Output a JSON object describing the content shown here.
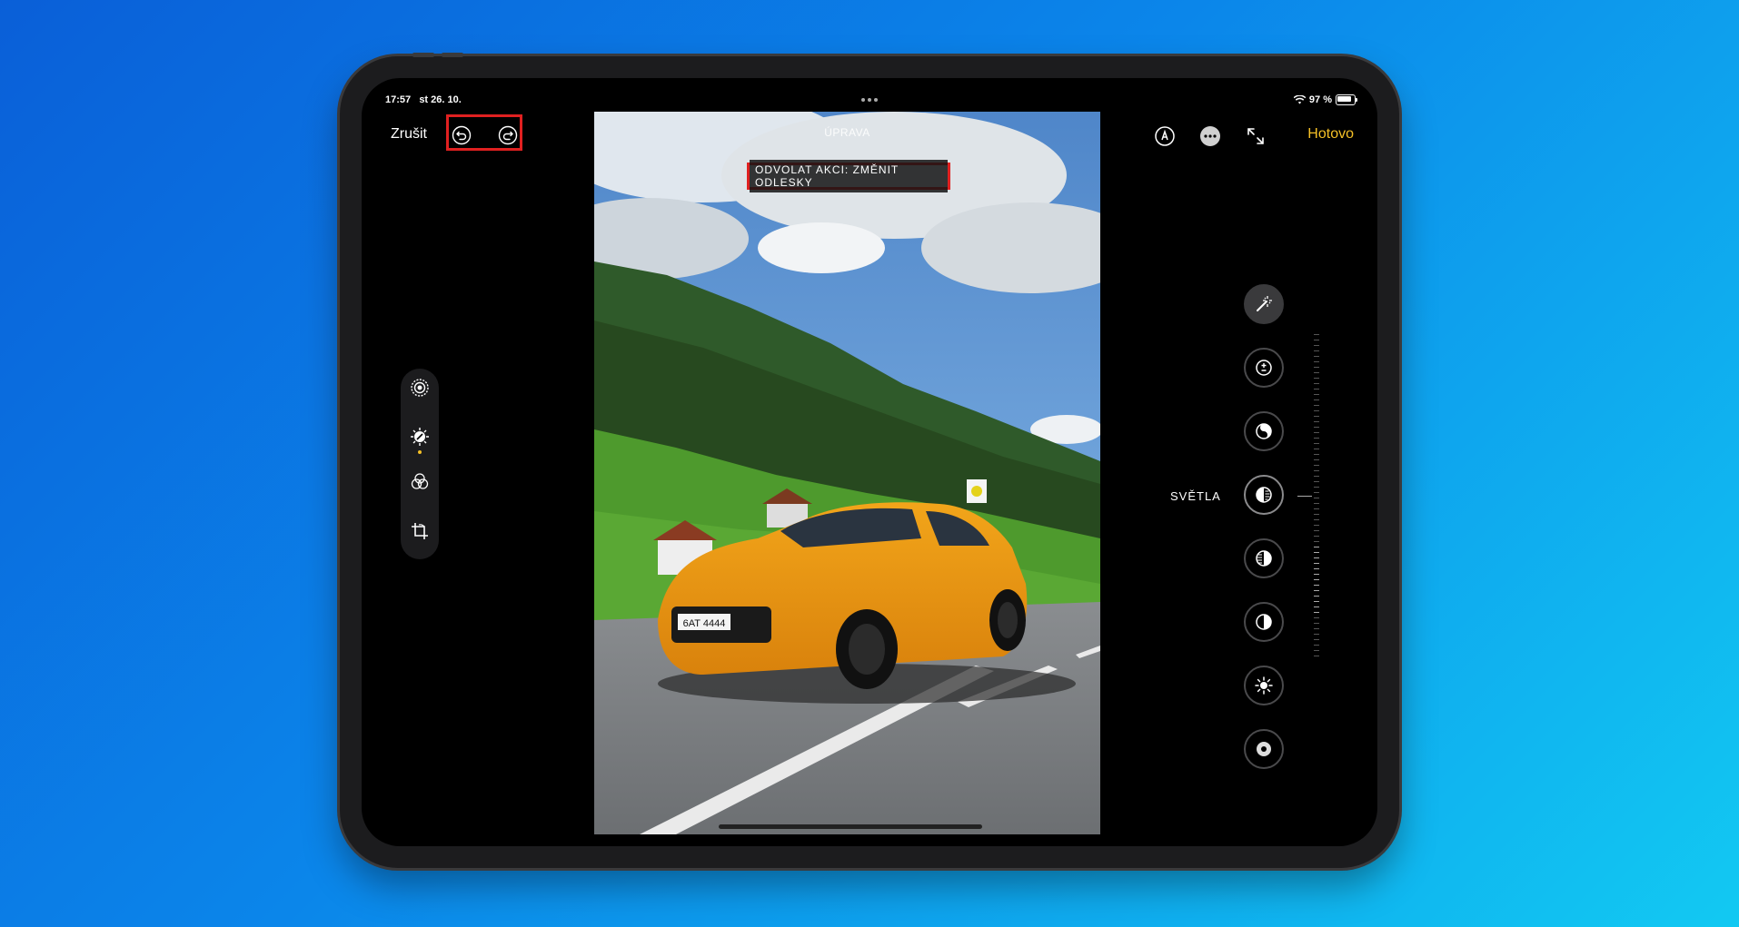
{
  "status_bar": {
    "time": "17:57",
    "date": "st 26. 10.",
    "battery": "97 %"
  },
  "toolbar": {
    "cancel_label": "Zrušit",
    "done_label": "Hotovo",
    "title": "ÚPRAVA"
  },
  "undo_banner": {
    "text": "ODVOLAT AKCI: ZMĚNIT ODLESKY"
  },
  "adjustment": {
    "current_label": "SVĚTLA"
  },
  "photo": {
    "license_plate": "6AT 4444"
  },
  "colors": {
    "accent": "#f5c026",
    "highlight_box": "#e02020",
    "background_start": "#0a5fd8",
    "background_end": "#12c9f2"
  },
  "icons": {
    "undo": "undo-icon",
    "redo": "redo-icon",
    "markup": "markup-pen-icon",
    "more": "more-icon",
    "expand": "expand-icon",
    "live": "live-photo-icon",
    "adjust": "adjust-dial-icon",
    "filters": "filters-icon",
    "crop": "crop-rotate-icon",
    "tools": [
      "magic-wand-icon",
      "exposure-icon",
      "brilliance-icon",
      "highlights-icon",
      "shadows-icon",
      "contrast-icon",
      "brightness-icon",
      "black-point-icon"
    ]
  }
}
